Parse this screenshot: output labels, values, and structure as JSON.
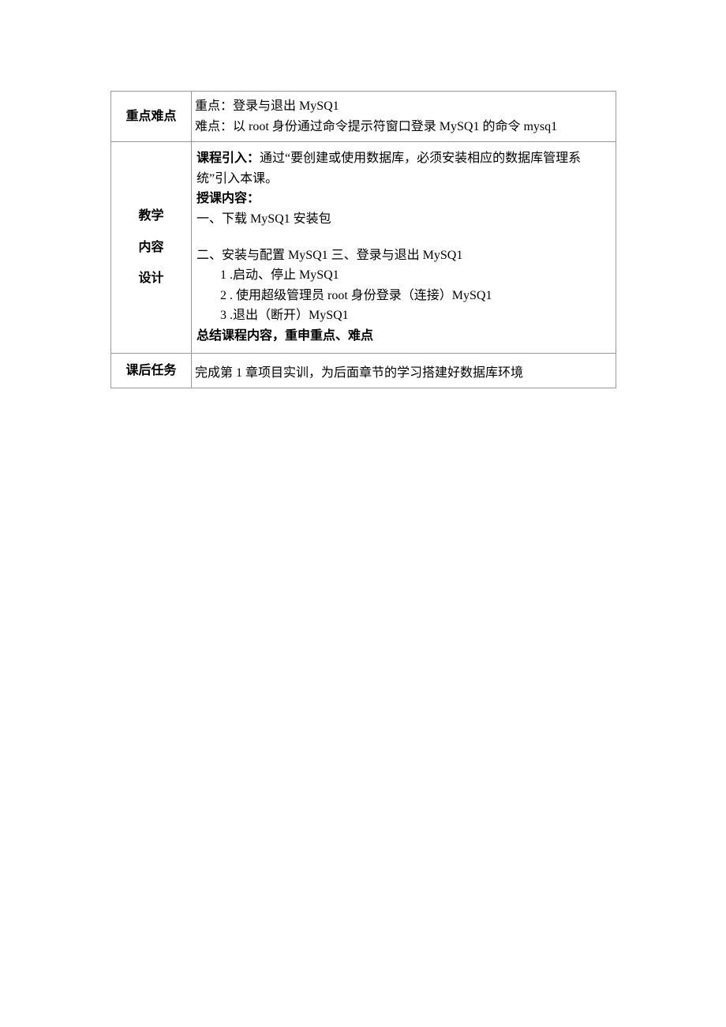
{
  "rows": {
    "keypoints": {
      "label": "重点难点",
      "line1": "重点：登录与退出 MySQ1",
      "line2": "难点：以 root 身份通过命令提示符窗口登录 MySQ1 的命令 mysq1"
    },
    "teaching": {
      "label1": "教学",
      "label2": "内容",
      "label3": "设计",
      "intro_bold": "课程引入：",
      "intro_rest": "通过“要创建或使用数据库，必须安装相应的数据库管理系统”引入本课。",
      "content_label": "授课内容：",
      "sec1": "一、下载 MySQ1 安装包",
      "sec2": "二、安装与配置 MySQ1 三、登录与退出 MySQ1",
      "item1": "1 .启动、停止 MySQ1",
      "item2": "2 . 使用超级管理员 root 身份登录（连接）MySQ1",
      "item3": "3 .退出（断开）MySQ1",
      "summary": "总结课程内容，重申重点、难点"
    },
    "homework": {
      "label": "课后任务",
      "text": "完成第 1 章项目实训，为后面章节的学习搭建好数据库环境"
    }
  }
}
